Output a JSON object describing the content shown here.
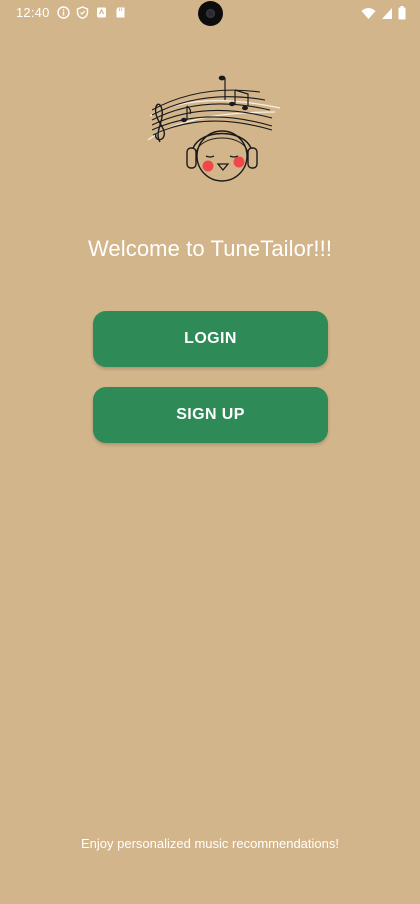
{
  "status_bar": {
    "time": "12:40",
    "left_icons": [
      "info-icon",
      "shield-icon",
      "app-icon",
      "sd-card-icon"
    ],
    "right_icons": [
      "wifi-icon",
      "cellular-icon",
      "battery-icon"
    ]
  },
  "logo": {
    "icon": "music-headphones-logo",
    "cheek_color": "#f04848"
  },
  "welcome": {
    "title": "Welcome to TuneTailor!!!"
  },
  "actions": {
    "login_label": "LOGIN",
    "signup_label": "SIGN UP",
    "button_color": "#2e8b57"
  },
  "footer": {
    "tagline": "Enjoy personalized music recommendations!"
  },
  "theme": {
    "background": "#d3b58b"
  }
}
